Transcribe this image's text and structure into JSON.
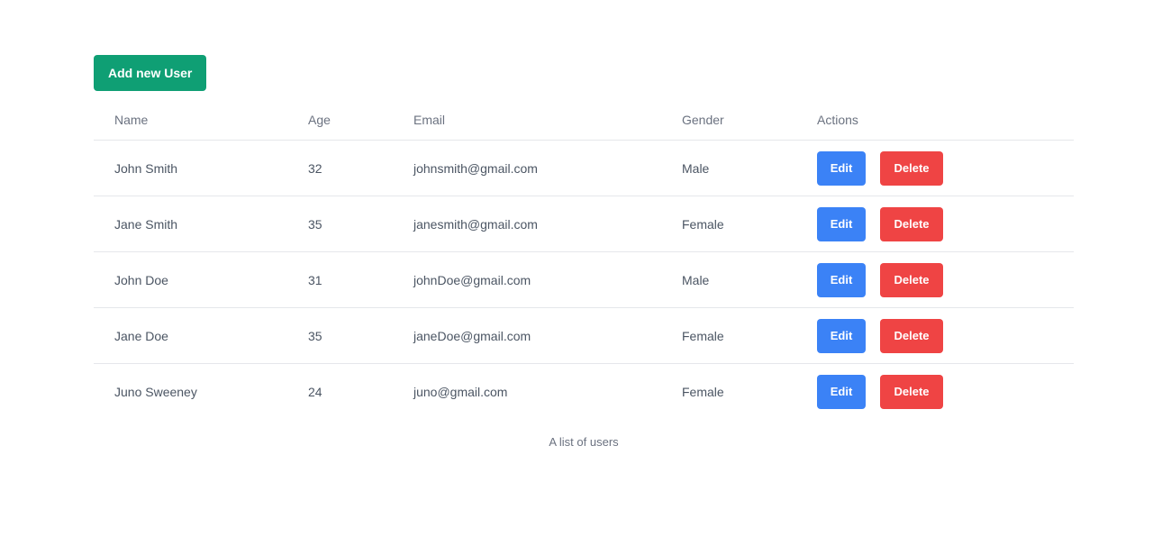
{
  "toolbar": {
    "add_user_label": "Add new User"
  },
  "table": {
    "headers": {
      "name": "Name",
      "age": "Age",
      "email": "Email",
      "gender": "Gender",
      "actions": "Actions"
    },
    "rows": [
      {
        "name": "John Smith",
        "age": "32",
        "email": "johnsmith@gmail.com",
        "gender": "Male"
      },
      {
        "name": "Jane Smith",
        "age": "35",
        "email": "janesmith@gmail.com",
        "gender": "Female"
      },
      {
        "name": "John Doe",
        "age": "31",
        "email": "johnDoe@gmail.com",
        "gender": "Male"
      },
      {
        "name": "Jane Doe",
        "age": "35",
        "email": "janeDoe@gmail.com",
        "gender": "Female"
      },
      {
        "name": "Juno Sweeney",
        "age": "24",
        "email": "juno@gmail.com",
        "gender": "Female"
      }
    ],
    "edit_label": "Edit",
    "delete_label": "Delete",
    "caption": "A list of users"
  },
  "colors": {
    "add_button": "#0f9f74",
    "edit_button": "#3b82f6",
    "delete_button": "#ef4444"
  }
}
